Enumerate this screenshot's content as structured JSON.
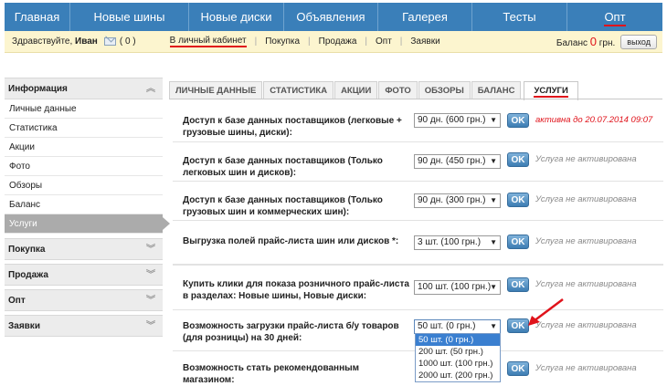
{
  "nav": {
    "items": [
      "Главная",
      "Новые шины",
      "Новые диски",
      "Объявления",
      "Галерея",
      "Тесты",
      "Опт"
    ]
  },
  "userbar": {
    "greeting": "Здравствуйте,",
    "user_name": "Иван",
    "messages": "( 0 )",
    "cabinet_link": "В личный кабинет",
    "links": [
      "Покупка",
      "Продажа",
      "Опт",
      "Заявки"
    ],
    "balance_label": "Баланс",
    "balance_value": "0",
    "balance_unit": "грн.",
    "exit_label": "выход"
  },
  "sidebar": {
    "sections": [
      {
        "title": "Информация",
        "items": [
          "Личные данные",
          "Статистика",
          "Акции",
          "Фото",
          "Обзоры",
          "Баланс",
          "Услуги"
        ],
        "active": "Услуги"
      },
      {
        "title": "Покупка"
      },
      {
        "title": "Продажа"
      },
      {
        "title": "Опт"
      },
      {
        "title": "Заявки"
      }
    ]
  },
  "tabs": [
    "ЛИЧНЫЕ ДАННЫЕ",
    "СТАТИСТИКА",
    "АКЦИИ",
    "ФОТО",
    "ОБЗОРЫ",
    "БАЛАНС",
    "УСЛУГИ"
  ],
  "active_tab": "УСЛУГИ",
  "services": [
    {
      "label": "Доступ к базе данных поставщиков (легковые + грузовые шины, диски):",
      "select": "90 дн. (600 грн.)",
      "ok": "OK",
      "status": "активна до 20.07.2014 09:07",
      "active": true
    },
    {
      "label": "Доступ к базе данных поставщиков (Только легковых шин и дисков):",
      "select": "90 дн. (450 грн.)",
      "ok": "OK",
      "status": "Услуга не активирована"
    },
    {
      "label": "Доступ к базе данных поставщиков (Только грузовых шин и коммерческих шин):",
      "select": "90 дн. (300 грн.)",
      "ok": "OK",
      "status": "Услуга не активирована"
    },
    {
      "label": "Выгрузка полей прайс-листа шин или дисков *:",
      "select": "3 шт. (100 грн.)",
      "ok": "OK",
      "status": "Услуга не активирована"
    },
    {
      "label": "Купить клики для показа розничного прайс-листа в разделах: Новые шины, Новые диски:",
      "select": "100 шт. (100 грн.)",
      "ok": "OK",
      "status": "Услуга не активирована"
    },
    {
      "label": "Возможность загрузки прайс-листа б/у товаров (для розницы) на 30 дней:",
      "select": "50 шт. (0 грн.)",
      "ok": "OK",
      "status": "Услуга не активирована"
    },
    {
      "label": "Возможность стать рекомендованным магазином:",
      "select": "",
      "ok": "OK",
      "status": "Услуга не активирована"
    }
  ],
  "dropdown_options": [
    "50 шт. (0 грн.)",
    "200 шт. (50 грн.)",
    "1000 шт. (100 грн.)",
    "2000 шт. (200 грн.)"
  ],
  "colors": {
    "nav_bg": "#3a7fb9",
    "userbar_bg": "#fcf5cf",
    "accent_red": "#e0131b",
    "ok_button": "#3d7db3"
  }
}
